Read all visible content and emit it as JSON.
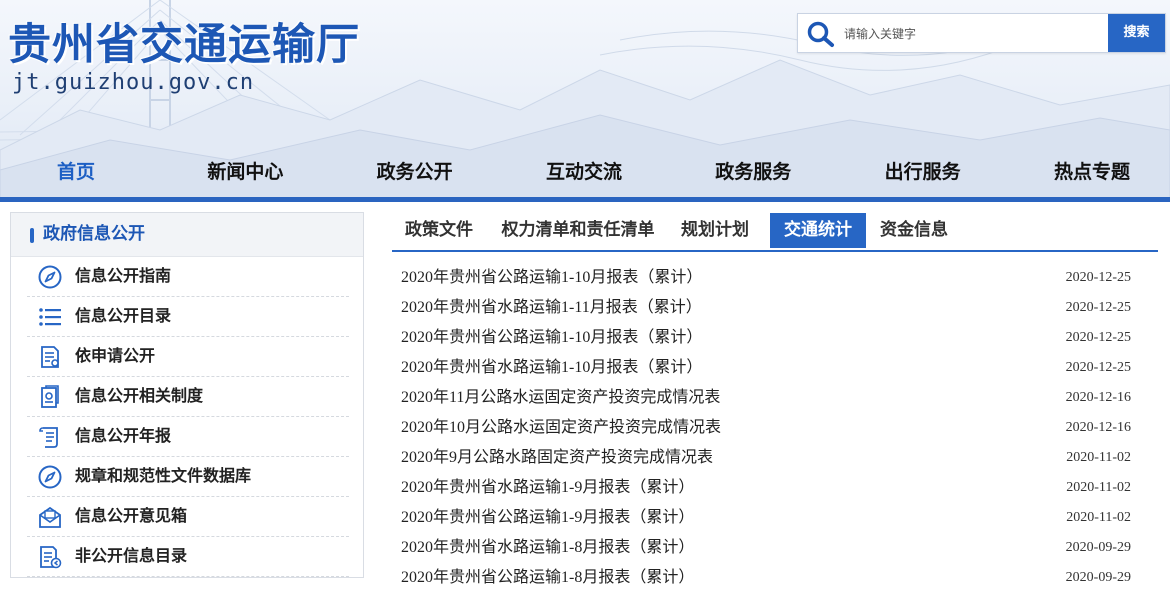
{
  "header": {
    "title": "贵州省交通运输厅",
    "domain": "jt.guizhou.gov.cn",
    "search": {
      "placeholder": "请输入关键字",
      "button": "搜索"
    }
  },
  "nav": {
    "items": [
      {
        "label": "首页",
        "active": true
      },
      {
        "label": "新闻中心"
      },
      {
        "label": "政务公开"
      },
      {
        "label": "互动交流"
      },
      {
        "label": "政务服务"
      },
      {
        "label": "出行服务"
      },
      {
        "label": "热点专题"
      }
    ]
  },
  "sidebar": {
    "title": "政府信息公开",
    "items": [
      {
        "label": "信息公开指南",
        "icon": "compass-icon"
      },
      {
        "label": "信息公开目录",
        "icon": "list-icon"
      },
      {
        "label": "依申请公开",
        "icon": "document-icon"
      },
      {
        "label": "信息公开相关制度",
        "icon": "policy-document-icon"
      },
      {
        "label": "信息公开年报",
        "icon": "report-scroll-icon"
      },
      {
        "label": "规章和规范性文件数据库",
        "icon": "compass-icon"
      },
      {
        "label": "信息公开意见箱",
        "icon": "mailbox-icon"
      },
      {
        "label": "非公开信息目录",
        "icon": "document-list-icon"
      }
    ]
  },
  "tabs": {
    "items": [
      {
        "label": "政策文件"
      },
      {
        "label": "权力清单和责任清单"
      },
      {
        "label": "规划计划"
      },
      {
        "label": "交通统计",
        "active": true
      },
      {
        "label": "资金信息"
      }
    ]
  },
  "articles": [
    {
      "title": "2020年贵州省公路运输1-10月报表（累计）",
      "date": "2020-12-25"
    },
    {
      "title": "2020年贵州省水路运输1-11月报表（累计）",
      "date": "2020-12-25"
    },
    {
      "title": "2020年贵州省公路运输1-10月报表（累计）",
      "date": "2020-12-25"
    },
    {
      "title": "2020年贵州省水路运输1-10月报表（累计）",
      "date": "2020-12-25"
    },
    {
      "title": "2020年11月公路水运固定资产投资完成情况表",
      "date": "2020-12-16"
    },
    {
      "title": "2020年10月公路水运固定资产投资完成情况表",
      "date": "2020-12-16"
    },
    {
      "title": "2020年9月公路水路固定资产投资完成情况表",
      "date": "2020-11-02"
    },
    {
      "title": "2020年贵州省水路运输1-9月报表（累计）",
      "date": "2020-11-02"
    },
    {
      "title": "2020年贵州省公路运输1-9月报表（累计）",
      "date": "2020-11-02"
    },
    {
      "title": "2020年贵州省水路运输1-8月报表（累计）",
      "date": "2020-09-29"
    },
    {
      "title": "2020年贵州省公路运输1-8月报表（累计）",
      "date": "2020-09-29"
    }
  ],
  "colors": {
    "brand_blue": "#2766c5",
    "title_blue": "#1d57b5"
  }
}
